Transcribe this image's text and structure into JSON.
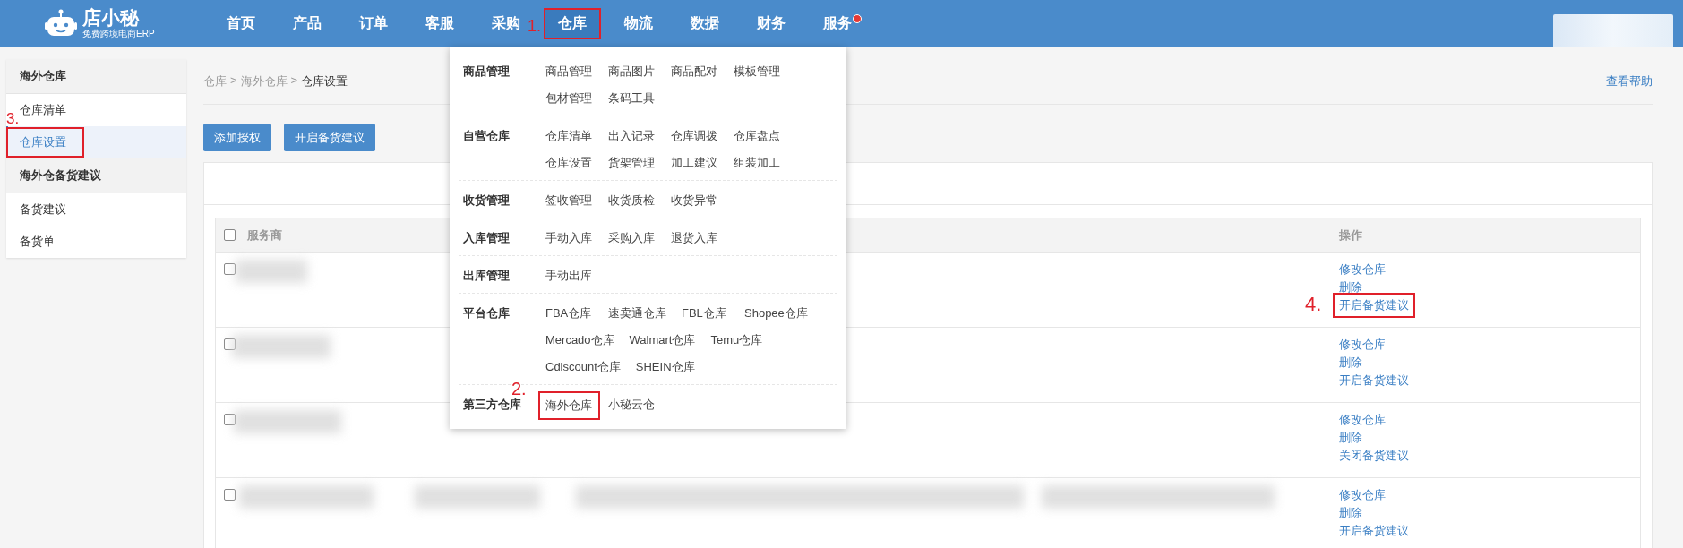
{
  "header": {
    "logo": {
      "name": "店小秘",
      "tagline": "免费跨境电商ERP"
    },
    "nav": [
      {
        "label": "首页",
        "selected": false,
        "badge": false
      },
      {
        "label": "产品",
        "selected": false,
        "badge": false
      },
      {
        "label": "订单",
        "selected": false,
        "badge": false
      },
      {
        "label": "客服",
        "selected": false,
        "badge": false
      },
      {
        "label": "采购",
        "selected": false,
        "badge": false
      },
      {
        "label": "仓库",
        "selected": true,
        "badge": false,
        "annotation": "1."
      },
      {
        "label": "物流",
        "selected": false,
        "badge": false
      },
      {
        "label": "数据",
        "selected": false,
        "badge": false
      },
      {
        "label": "财务",
        "selected": false,
        "badge": false
      },
      {
        "label": "服务",
        "selected": false,
        "badge": true
      }
    ]
  },
  "dropdown": {
    "groups": [
      {
        "title": "商品管理",
        "items": [
          {
            "label": "商品管理"
          },
          {
            "label": "商品图片"
          },
          {
            "label": "商品配对"
          },
          {
            "label": "模板管理"
          },
          {
            "label": "包材管理"
          },
          {
            "label": "条码工具"
          }
        ]
      },
      {
        "title": "自营仓库",
        "items": [
          {
            "label": "仓库清单"
          },
          {
            "label": "出入记录"
          },
          {
            "label": "仓库调拨"
          },
          {
            "label": "仓库盘点"
          },
          {
            "label": "仓库设置"
          },
          {
            "label": "货架管理"
          },
          {
            "label": "加工建议"
          },
          {
            "label": "组装加工"
          }
        ]
      },
      {
        "title": "收货管理",
        "items": [
          {
            "label": "签收管理"
          },
          {
            "label": "收货质检"
          },
          {
            "label": "收货异常"
          }
        ]
      },
      {
        "title": "入库管理",
        "items": [
          {
            "label": "手动入库"
          },
          {
            "label": "采购入库"
          },
          {
            "label": "退货入库"
          }
        ]
      },
      {
        "title": "出库管理",
        "items": [
          {
            "label": "手动出库"
          }
        ]
      },
      {
        "title": "平台仓库",
        "items": [
          {
            "label": "FBA仓库"
          },
          {
            "label": "速卖通仓库"
          },
          {
            "label": "FBL仓库"
          },
          {
            "label": "Shopee仓库"
          },
          {
            "label": "Mercado仓库"
          },
          {
            "label": "Walmart仓库"
          },
          {
            "label": "Temu仓库"
          },
          {
            "label": "Cdiscount仓库"
          },
          {
            "label": "SHEIN仓库"
          }
        ]
      },
      {
        "title": "第三方仓库",
        "items": [
          {
            "label": "海外仓库",
            "annotation": "2."
          },
          {
            "label": "小秘云仓"
          }
        ]
      }
    ]
  },
  "sidebar": [
    {
      "title": "海外仓库",
      "items": [
        {
          "label": "仓库清单",
          "selected": false
        },
        {
          "label": "仓库设置",
          "selected": true,
          "annotation": "3."
        }
      ]
    },
    {
      "title": "海外仓备货建议",
      "items": [
        {
          "label": "备货建议",
          "selected": false
        },
        {
          "label": "备货单",
          "selected": false
        }
      ]
    }
  ],
  "breadcrumb": {
    "items": [
      "仓库",
      "海外仓库",
      "仓库设置"
    ],
    "separator": ">"
  },
  "help_link": "查看帮助",
  "buttons": [
    "添加授权",
    "开启备货建议"
  ],
  "table": {
    "select_all": false,
    "columns": [
      "服务商",
      "操作"
    ],
    "rows": [
      {
        "checked": false,
        "actions": [
          {
            "label": "修改仓库"
          },
          {
            "label": "删除"
          },
          {
            "label": "开启备货建议",
            "annotation": "4."
          }
        ]
      },
      {
        "checked": false,
        "actions": [
          {
            "label": "修改仓库"
          },
          {
            "label": "删除"
          },
          {
            "label": "开启备货建议"
          }
        ]
      },
      {
        "checked": false,
        "actions": [
          {
            "label": "修改仓库"
          },
          {
            "label": "删除"
          },
          {
            "label": "关闭备货建议"
          }
        ]
      },
      {
        "checked": false,
        "actions": [
          {
            "label": "修改仓库"
          },
          {
            "label": "删除"
          },
          {
            "label": "开启备货建议"
          }
        ]
      }
    ]
  }
}
